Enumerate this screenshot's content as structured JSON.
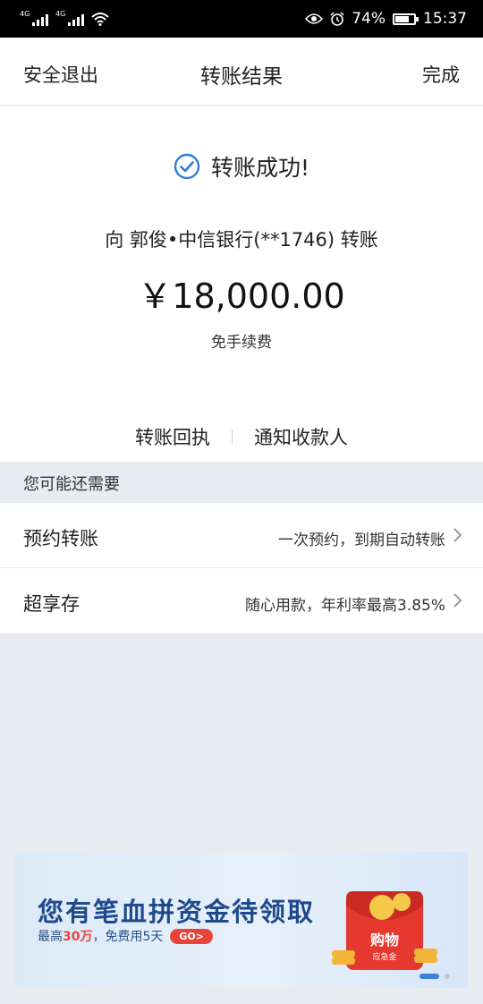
{
  "status_bar": {
    "net1": "4G",
    "net2": "4G",
    "battery": "74%",
    "battery_level": 0.74,
    "time": "15:37"
  },
  "nav": {
    "left_label": "安全退出",
    "title": "转账结果",
    "right_label": "完成"
  },
  "result": {
    "success_text": "转账成功!",
    "recipient_line": "向  郭俊•中信银行(**1746)  转账",
    "amount": "￥18,000.00",
    "fee_text": "免手续费",
    "accent_color": "#2f7bd6"
  },
  "actions": {
    "receipt_label": "转账回执",
    "notify_label": "通知收款人"
  },
  "suggestions": {
    "header": "您可能还需要",
    "items": [
      {
        "title": "预约转账",
        "desc": "一次预约，到期自动转账"
      },
      {
        "title": "超享存",
        "desc": "随心用款，年利率最高3.85%"
      }
    ]
  },
  "banner": {
    "title": "您有笔血拼资金待领取",
    "sub_prefix": "最高",
    "sub_amount": "30万",
    "sub_mid": "，免费用",
    "sub_days": "5天",
    "go_label": "GO>",
    "art_text_1": "购物",
    "art_text_2": "应急金"
  }
}
